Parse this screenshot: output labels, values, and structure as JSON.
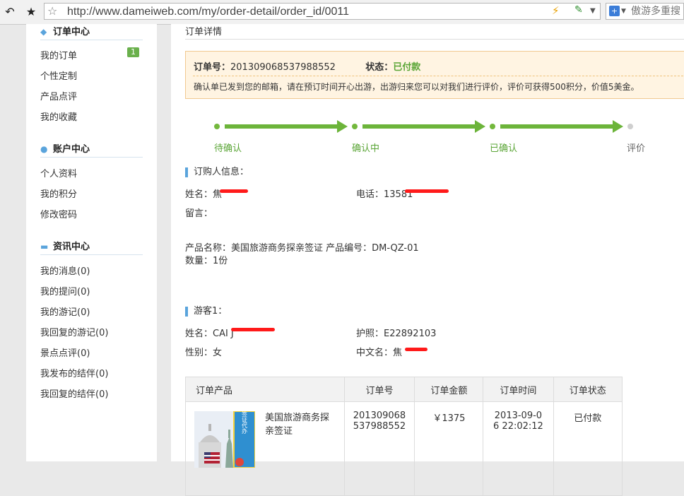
{
  "browser": {
    "url": "http://www.dameiweb.com/my/order-detail/order_id/0011",
    "search_placeholder": "傲游多重搜"
  },
  "sidebar": {
    "sections": [
      {
        "title": "订单中心",
        "icon": "tag-icon",
        "items": [
          {
            "label": "我的订单",
            "badge": "1"
          },
          {
            "label": "个性定制"
          },
          {
            "label": "产品点评"
          },
          {
            "label": "我的收藏"
          }
        ]
      },
      {
        "title": "账户中心",
        "icon": "user-icon",
        "items": [
          {
            "label": "个人资料"
          },
          {
            "label": "我的积分"
          },
          {
            "label": "修改密码"
          }
        ]
      },
      {
        "title": "资讯中心",
        "icon": "chat-bubble-icon",
        "items": [
          {
            "label": "我的消息(0)"
          },
          {
            "label": "我的提问(0)"
          },
          {
            "label": "我的游记(0)"
          },
          {
            "label": "我回复的游记(0)"
          },
          {
            "label": "景点点评(0)"
          },
          {
            "label": "我发布的结伴(0)"
          },
          {
            "label": "我回复的结伴(0)"
          }
        ]
      }
    ]
  },
  "main": {
    "title": "订单详情",
    "notice": {
      "order_no_label": "订单号：",
      "order_no": "201309068537988552",
      "status_label": "状态：",
      "status": "已付款",
      "message": "确认单已发到您的邮箱，请在预订时间开心出游，出游归来您可以对我们进行评价，评价可获得500积分，价值5美金。"
    },
    "progress": {
      "steps": [
        "待确认",
        "确认中",
        "已确认",
        "评价"
      ],
      "completed": 3
    },
    "buyer": {
      "heading": "订购人信息：",
      "name_label": "姓名：焦",
      "phone_label": "电话：13581",
      "remark_label": "留言：",
      "product_line": "产品名称：美国旅游商务探亲签证    产品编号：DM-QZ-01",
      "quantity_line": "数量：1份"
    },
    "traveler": {
      "heading": "游客1：",
      "name_label": "姓名：CAI J",
      "passport_label": "护照：E22892103",
      "gender_label": "性别：女",
      "cn_name_label": "中文名：焦"
    },
    "table": {
      "headers": [
        "订单产品",
        "订单号",
        "订单金额",
        "订单时间",
        "订单状态"
      ],
      "row": {
        "product": "美国旅游商务探亲签证",
        "image_text": "美国签证代办",
        "order_no_l1": "201309068",
        "order_no_l2": "537988552",
        "amount": "￥1375",
        "time_l1": "2013-09-0",
        "time_l2": "6 22:02:12",
        "status": "已付款"
      }
    }
  }
}
